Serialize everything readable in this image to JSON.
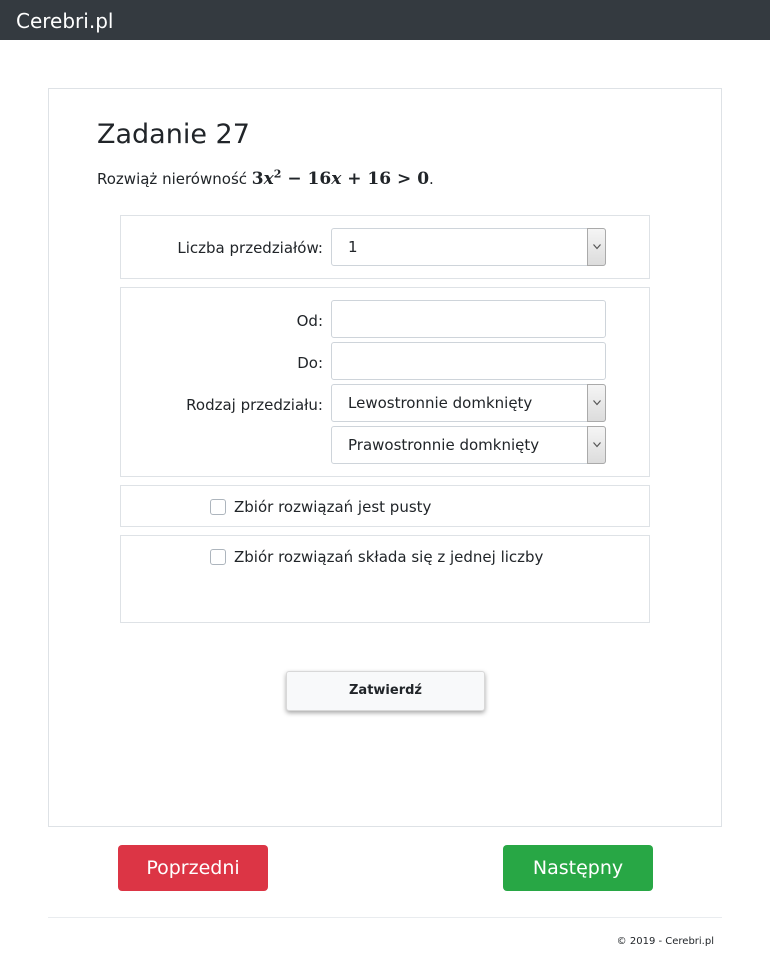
{
  "navbar": {
    "brand": "Cerebri.pl"
  },
  "task": {
    "title": "Zadanie 27",
    "prompt": "Rozwiąż nierówność",
    "formula": {
      "a": "3",
      "var": "x",
      "exp": "2",
      "rest_op1": "−",
      "b": "16",
      "op2": "+",
      "c": "16",
      "rel": ">",
      "rhs": "0"
    },
    "end": "."
  },
  "intervals": {
    "label": "Liczba przedziałów:",
    "value": "1"
  },
  "interval_form": {
    "from_label": "Od:",
    "from_value": "",
    "to_label": "Do:",
    "to_value": "",
    "type_label": "Rodzaj przedziału:",
    "left_type": "Lewostronnie domknięty",
    "right_type": "Prawostronnie domknięty"
  },
  "options": {
    "empty_set": "Zbiór rozwiązań jest pusty",
    "single_number": "Zbiór rozwiązań składa się z jednej liczby"
  },
  "submit_label": "Zatwierdź",
  "nav_buttons": {
    "prev": "Poprzedni",
    "next": "Następny"
  },
  "footer": {
    "copyright": "© 2019 - Cerebri.pl"
  },
  "colors": {
    "navbar": "#343a40",
    "prev": "#dc3545",
    "next": "#28a745"
  }
}
